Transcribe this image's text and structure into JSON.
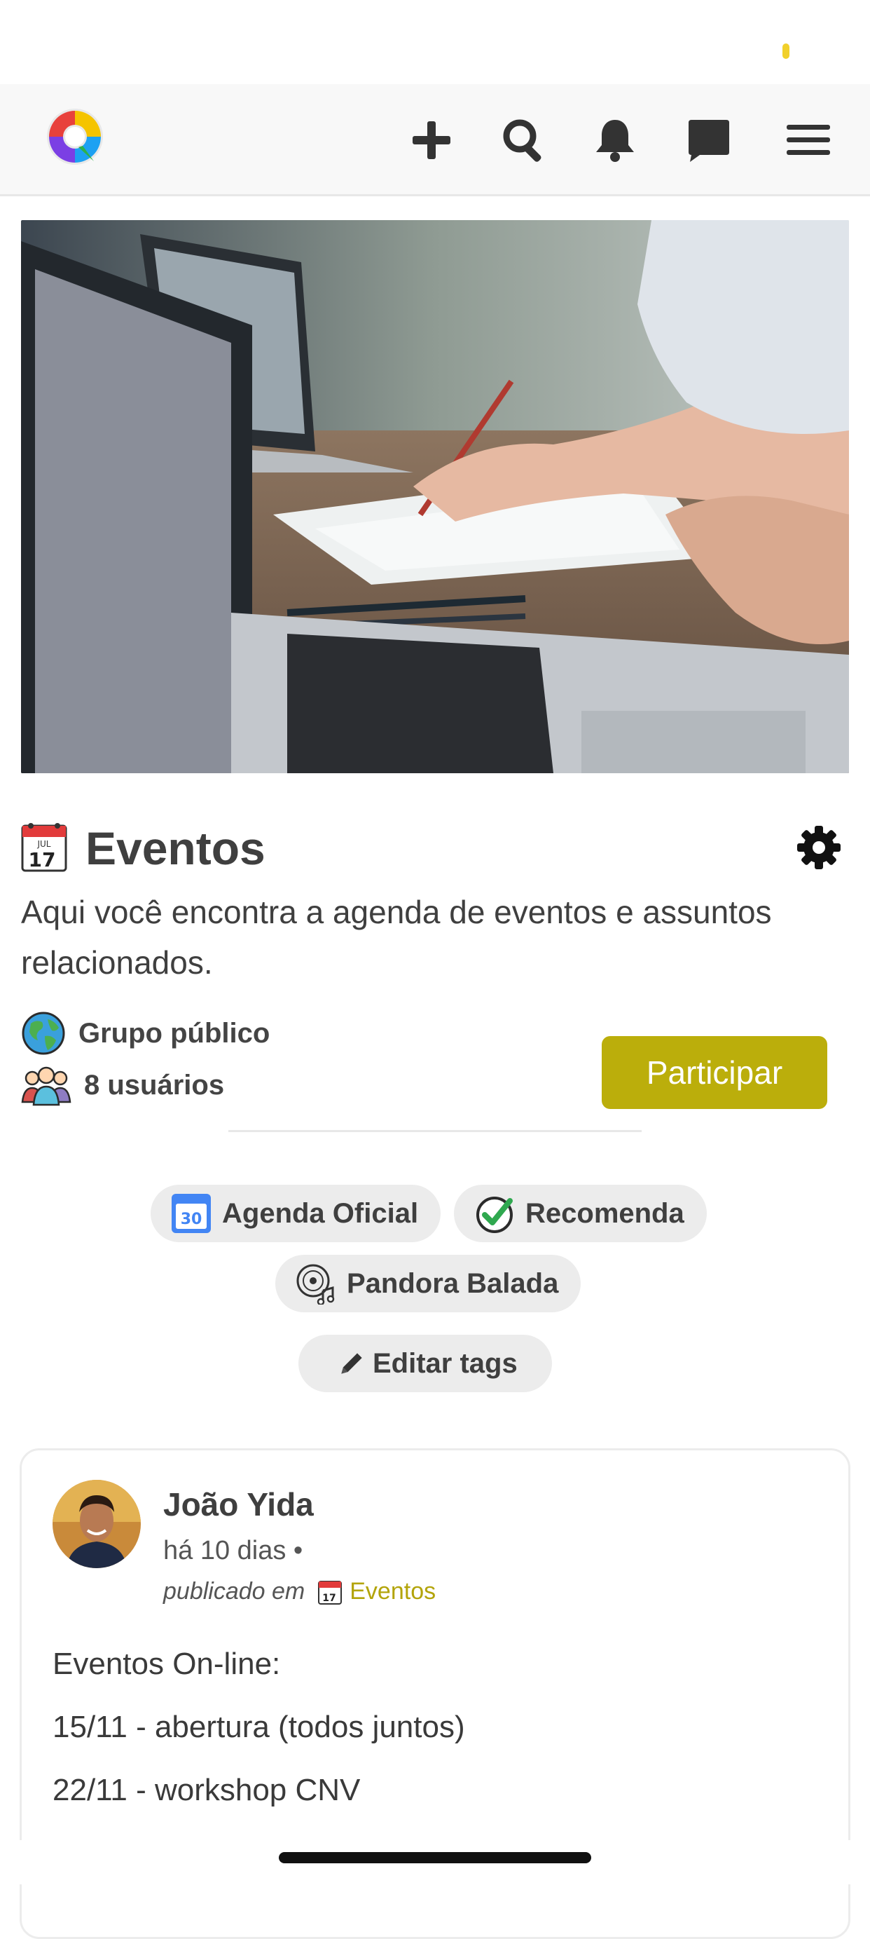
{
  "navbar": {
    "icons": [
      "plus-icon",
      "search-icon",
      "bell-icon",
      "chat-icon",
      "menu-icon"
    ]
  },
  "group": {
    "title": "Eventos",
    "description": "Aqui você encontra a agenda de eventos e assuntos relacionados.",
    "visibility": "Grupo público",
    "members": "8 usuários",
    "join_label": "Participar",
    "calendar_icon": {
      "month": "JUL",
      "day": "17"
    }
  },
  "tags": [
    {
      "label": "Agenda Oficial",
      "icon": "calendar-30-icon",
      "icon_text": "30"
    },
    {
      "label": "Recomenda",
      "icon": "check-circle-icon"
    },
    {
      "label": "Pandora Balada",
      "icon": "vinyl-music-icon"
    }
  ],
  "edit_tags_label": "Editar tags",
  "post": {
    "author": "João Yida",
    "time_ago": "há 10 dias •",
    "published_in": "publicado em",
    "group_link": "Eventos",
    "lines": [
      "Eventos On-line:",
      "15/11 - abertura (todos juntos)",
      "22/11 - workshop CNV"
    ]
  },
  "colors": {
    "accent": "#bbae0b",
    "tag_bg": "#ececec",
    "navbar_bg": "#f8f8f8"
  }
}
